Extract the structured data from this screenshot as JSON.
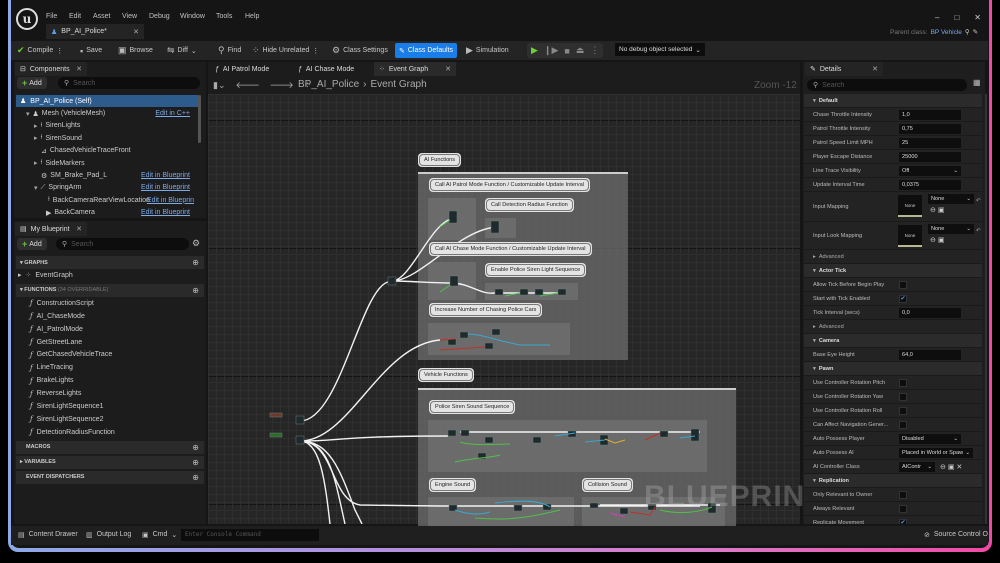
{
  "menu": [
    "File",
    "Edit",
    "Asset",
    "View",
    "Debug",
    "Window",
    "Tools",
    "Help"
  ],
  "asset_tab": "BP_AI_Police*",
  "parent_class": {
    "label": "Parent class:",
    "value": "BP Vehicle"
  },
  "toolbar": {
    "compile": "Compile",
    "save": "Save",
    "browse": "Browse",
    "diff": "Diff",
    "find": "Find",
    "hide_unrelated": "Hide Unrelated",
    "class_settings": "Class Settings",
    "class_defaults": "Class Defaults",
    "simulation": "Simulation",
    "debug_object": "No debug object selected"
  },
  "components": {
    "tab": "Components",
    "add": "Add",
    "search_placeholder": "Search",
    "items": [
      {
        "label": "BP_AI_Police (Self)"
      },
      {
        "label": "Mesh (VehicleMesh)",
        "link": "Edit in C++"
      },
      {
        "label": "SirenLights"
      },
      {
        "label": "SirenSound"
      },
      {
        "label": "ChasedVehicleTraceFront"
      },
      {
        "label": "SideMarkers"
      },
      {
        "label": "SM_Brake_Pad_L",
        "link": "Edit in Blueprint"
      },
      {
        "label": "SpringArm",
        "link": "Edit in Blueprint"
      },
      {
        "label": "BackCameraRearViewLocation",
        "link": "Edit in Blueprin"
      },
      {
        "label": "BackCamera",
        "link": "Edit in Blueprint"
      }
    ]
  },
  "my_blueprint": {
    "tab": "My Blueprint",
    "add": "Add",
    "search_placeholder": "Search",
    "graphs": "GRAPHS",
    "event_graph": "EventGraph",
    "functions": "FUNCTIONS",
    "functions_count": "(34 OVERRIDABLE)",
    "function_items": [
      "ConstructionScript",
      "AI_ChaseMode",
      "AI_PatrolMode",
      "GetStreetLane",
      "GetChasedVehicleTrace",
      "LineTracing",
      "BrakeLights",
      "ReverseLights",
      "SirenLightSequence1",
      "SirenLightSequence2",
      "DetectionRadiusFunction"
    ],
    "macros": "MACROS",
    "variables": "VARIABLES",
    "event_dispatchers": "EVENT DISPATCHERS"
  },
  "graph": {
    "tabs": [
      "AI Patrol Mode",
      "AI Chase Mode",
      "Event Graph"
    ],
    "breadcrumb": [
      "BP_AI_Police",
      "Event Graph"
    ],
    "zoom": "Zoom -12",
    "watermark": "BLUEPRINT",
    "comments": {
      "ai_functions": "AI Functions",
      "patrol": "Call AI Patrol Mode Function / Customizable Update Interval",
      "detection": "Call Detection Radius Function",
      "chase": "Call AI Chase Mode Function / Customizable Update Interval",
      "siren_light": "Enable Police Siren Light Sequence",
      "increase": "Increase Number of Chasing Police Cars",
      "vehicle_functions": "Vehicle Functions",
      "siren_sound": "Police Siren Sound Sequence",
      "engine": "Engine Sound",
      "collision": "Collision Sound"
    }
  },
  "details": {
    "tab": "Details",
    "search_placeholder": "Search",
    "rows": [
      {
        "t": "h",
        "name": "Default"
      },
      {
        "name": "Chase Throttle Intensity",
        "value": "1,0"
      },
      {
        "name": "Patrol Throttle Intensity",
        "value": "0,75"
      },
      {
        "name": "Patrol Speed Limit MPH",
        "value": "25"
      },
      {
        "name": "Player Escape Distance",
        "value": "25000"
      },
      {
        "name": "Line Trace Visibility",
        "value": "Off",
        "dropdown": true
      },
      {
        "name": "Update Interval Time",
        "value": "0,0375"
      },
      {
        "t": "asset",
        "name": "Input Mapping",
        "value": "None",
        "thumb": "None"
      },
      {
        "t": "asset",
        "name": "Input Look Mapping",
        "value": "None",
        "thumb": "None"
      },
      {
        "t": "sub",
        "name": "Advanced"
      },
      {
        "t": "h",
        "name": "Actor Tick"
      },
      {
        "name": "Allow Tick Before Begin Play",
        "check": false
      },
      {
        "name": "Start with Tick Enabled",
        "check": true
      },
      {
        "name": "Tick Interval (secs)",
        "value": "0,0"
      },
      {
        "t": "sub",
        "name": "Advanced"
      },
      {
        "t": "h",
        "name": "Camera"
      },
      {
        "name": "Base Eye Height",
        "value": "64,0"
      },
      {
        "t": "h",
        "name": "Pawn"
      },
      {
        "name": "Use Controller Rotation Pitch",
        "check": false
      },
      {
        "name": "Use Controller Rotation Yaw",
        "check": false
      },
      {
        "name": "Use Controller Rotation Roll",
        "check": false
      },
      {
        "name": "Can Affect Navigation Gener...",
        "check": false
      },
      {
        "name": "Auto Possess Player",
        "value": "Disabled",
        "dropdown": true
      },
      {
        "name": "Auto Possess AI",
        "value": "Placed in World or Spaw",
        "dropdown": true
      },
      {
        "name": "AI Controller Class",
        "value": "AIContr",
        "dropdown": true
      },
      {
        "t": "h",
        "name": "Replication"
      },
      {
        "name": "Only Relevant to Owner",
        "check": false
      },
      {
        "name": "Always Relevant",
        "check": false
      },
      {
        "name": "Replicate Movement",
        "check": true
      }
    ]
  },
  "bottom": {
    "content_drawer": "Content Drawer",
    "output_log": "Output Log",
    "cmd": "Cmd",
    "console_placeholder": "Enter Console Command",
    "source_control": "Source Control O"
  },
  "colors": {
    "accent": "#1a7de8",
    "selected_row": "#2d5b8c",
    "link": "#7ea9e8",
    "play": "#6fd13a"
  }
}
